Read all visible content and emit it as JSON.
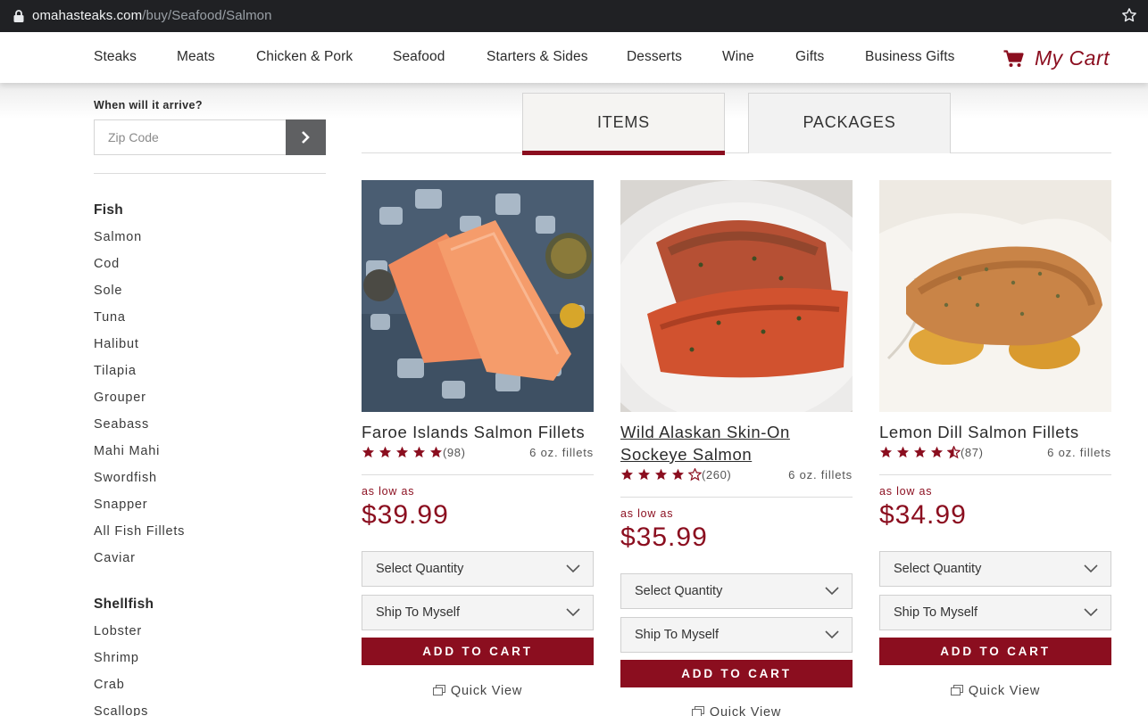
{
  "browser": {
    "url_host": "omahasteaks.com",
    "url_path": "/buy/Seafood/Salmon"
  },
  "nav": {
    "items": [
      "Steaks",
      "Meats",
      "Chicken & Pork",
      "Seafood",
      "Starters & Sides",
      "Desserts",
      "Wine",
      "Gifts",
      "Business Gifts"
    ],
    "cart_label": "My Cart"
  },
  "sidebar": {
    "arrive_label": "When will it arrive?",
    "zip_placeholder": "Zip Code",
    "fish_heading": "Fish",
    "fish": [
      "Salmon",
      "Cod",
      "Sole",
      "Tuna",
      "Halibut",
      "Tilapia",
      "Grouper",
      "Seabass",
      "Mahi Mahi",
      "Swordfish",
      "Snapper",
      "All Fish Fillets",
      "Caviar"
    ],
    "shellfish_heading": "Shellfish",
    "shellfish": [
      "Lobster",
      "Shrimp",
      "Crab",
      "Scallops"
    ]
  },
  "tabs": [
    "ITEMS",
    "PACKAGES"
  ],
  "products": [
    {
      "name": "Faroe Islands Salmon Fillets",
      "rating": 5,
      "reviews": "(98)",
      "portion": "6 oz. fillets",
      "low_label": "as low as",
      "price": "$39.99",
      "quantity_label": "Select Quantity",
      "ship_label": "Ship To Myself",
      "cart_button": "ADD TO CART",
      "quick_view": "Quick View"
    },
    {
      "name": "Wild Alaskan Skin-On Sockeye Salmon",
      "rating": 4,
      "reviews": "(260)",
      "portion": "6 oz. fillets",
      "low_label": "as low as",
      "price": "$35.99",
      "quantity_label": "Select Quantity",
      "ship_label": "Ship To Myself",
      "cart_button": "ADD TO CART",
      "quick_view": "Quick View"
    },
    {
      "name": "Lemon Dill Salmon Fillets",
      "rating": 4.5,
      "reviews": "(87)",
      "portion": "6 oz. fillets",
      "low_label": "as low as",
      "price": "$34.99",
      "quantity_label": "Select Quantity",
      "ship_label": "Ship To Myself",
      "cart_button": "ADD TO CART",
      "quick_view": "Quick View"
    }
  ],
  "colors": {
    "brand": "#8b0e1f",
    "zip_button": "#5f6062"
  }
}
